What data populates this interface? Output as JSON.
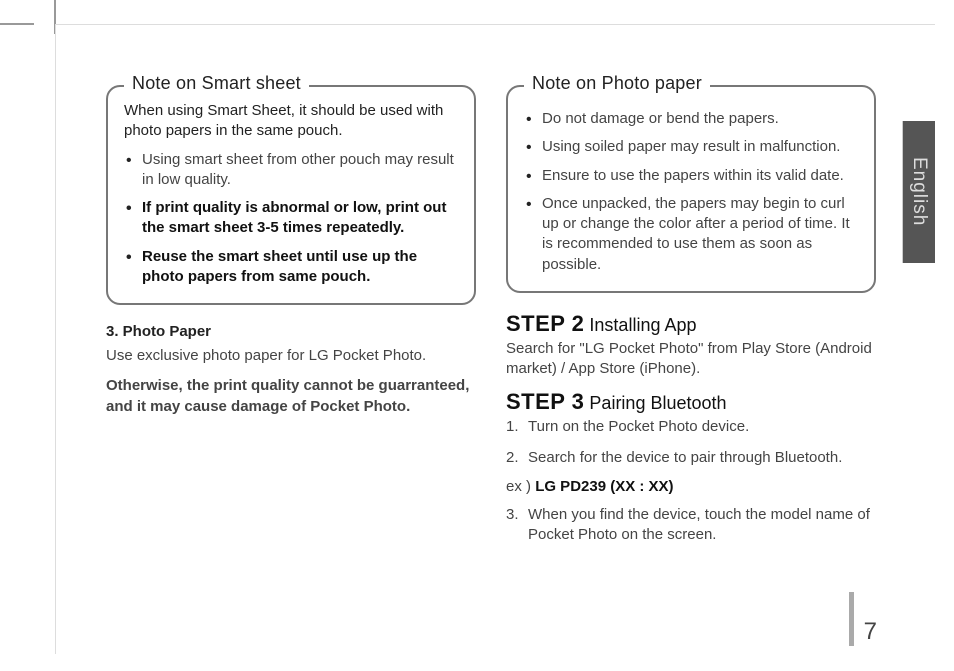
{
  "lang_tab": "English",
  "page_number": "7",
  "left": {
    "note_title": "Note on Smart sheet",
    "note_intro": "When using Smart Sheet, it should be used with photo papers in the same pouch.",
    "note_items": [
      {
        "text": "Using smart sheet from other pouch may result in low quality.",
        "bold": false
      },
      {
        "text": "If print quality is abnormal or low, print out the smart sheet 3-5 times repeatedly.",
        "bold": true
      },
      {
        "text": "Reuse the smart sheet until use up the photo papers from same pouch.",
        "bold": true
      }
    ],
    "subhead": "3.   Photo Paper",
    "body1": "Use exclusive photo paper for LG Pocket Photo.",
    "body2": "Otherwise, the print quality cannot be guarranteed, and it may cause damage of Pocket Photo."
  },
  "right": {
    "note_title": "Note on Photo paper",
    "note_items": [
      {
        "text": "Do not damage or bend the papers.",
        "bold": false
      },
      {
        "text": "Using soiled paper may result in malfunction.",
        "bold": false
      },
      {
        "text": "Ensure to use the papers within its valid date.",
        "bold": false
      },
      {
        "text": "Once unpacked, the papers may begin to curl up or change the color after a period of time. It is recommended to use them as soon as possible.",
        "bold": false
      }
    ],
    "step2_label": "STEP 2",
    "step2_title": " Installing App",
    "step2_body": "Search for \"LG Pocket Photo\" from Play Store (Android market) / App Store (iPhone).",
    "step3_label": "STEP 3",
    "step3_title": " Pairing Bluetooth",
    "step3_items": [
      "Turn on the Pocket Photo device.",
      "Search for the device to pair through Bluetooth."
    ],
    "ex_prefix": "ex ) ",
    "ex_code": "LG PD239 (XX : XX)",
    "step3_item3": "When you find the device, touch the model name of Pocket Photo on the screen."
  }
}
